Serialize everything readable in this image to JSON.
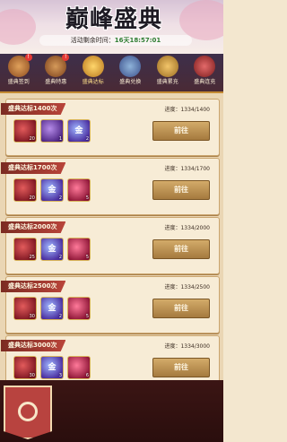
{
  "header": {
    "title": "巅峰盛典",
    "countdown_label": "活动剩余时间：",
    "countdown_value": "16天18:57:01"
  },
  "tabs": [
    {
      "label": "盛典签到",
      "icon": "scroll-icon",
      "badge": "!"
    },
    {
      "label": "盛典特惠",
      "icon": "gourd-icon",
      "badge": "!"
    },
    {
      "label": "盛典达标",
      "icon": "treasure-chest-icon",
      "badge": ""
    },
    {
      "label": "盛典兑换",
      "icon": "lantern-icon",
      "badge": ""
    },
    {
      "label": "盛典累充",
      "icon": "coin-icon",
      "badge": ""
    },
    {
      "label": "盛典连充",
      "icon": "gift-box-icon",
      "badge": ""
    }
  ],
  "cards": [
    {
      "title": "盛典达标1400次",
      "progress": "进度：1334/1400",
      "button": "前往",
      "rewards": [
        {
          "type": "red",
          "count": "20"
        },
        {
          "type": "purple",
          "count": "1"
        },
        {
          "type": "orb",
          "count": "2"
        }
      ]
    },
    {
      "title": "盛典达标1700次",
      "progress": "进度：1334/1700",
      "button": "前往",
      "rewards": [
        {
          "type": "red",
          "count": "20"
        },
        {
          "type": "orb",
          "count": "2"
        },
        {
          "type": "crimson",
          "count": "5"
        }
      ]
    },
    {
      "title": "盛典达标2000次",
      "progress": "进度：1334/2000",
      "button": "前往",
      "rewards": [
        {
          "type": "red",
          "count": "25"
        },
        {
          "type": "orb",
          "count": "2"
        },
        {
          "type": "crimson",
          "count": "5"
        }
      ]
    },
    {
      "title": "盛典达标2500次",
      "progress": "进度：1334/2500",
      "button": "前往",
      "rewards": [
        {
          "type": "red",
          "count": "30"
        },
        {
          "type": "orb",
          "count": "2"
        },
        {
          "type": "crimson",
          "count": "5"
        }
      ]
    },
    {
      "title": "盛典达标3000次",
      "progress": "进度：1334/3000",
      "button": "前往",
      "rewards": [
        {
          "type": "red",
          "count": "30"
        },
        {
          "type": "orb",
          "count": "3"
        },
        {
          "type": "crimson",
          "count": "6"
        }
      ]
    }
  ],
  "orb_glyph": "金"
}
